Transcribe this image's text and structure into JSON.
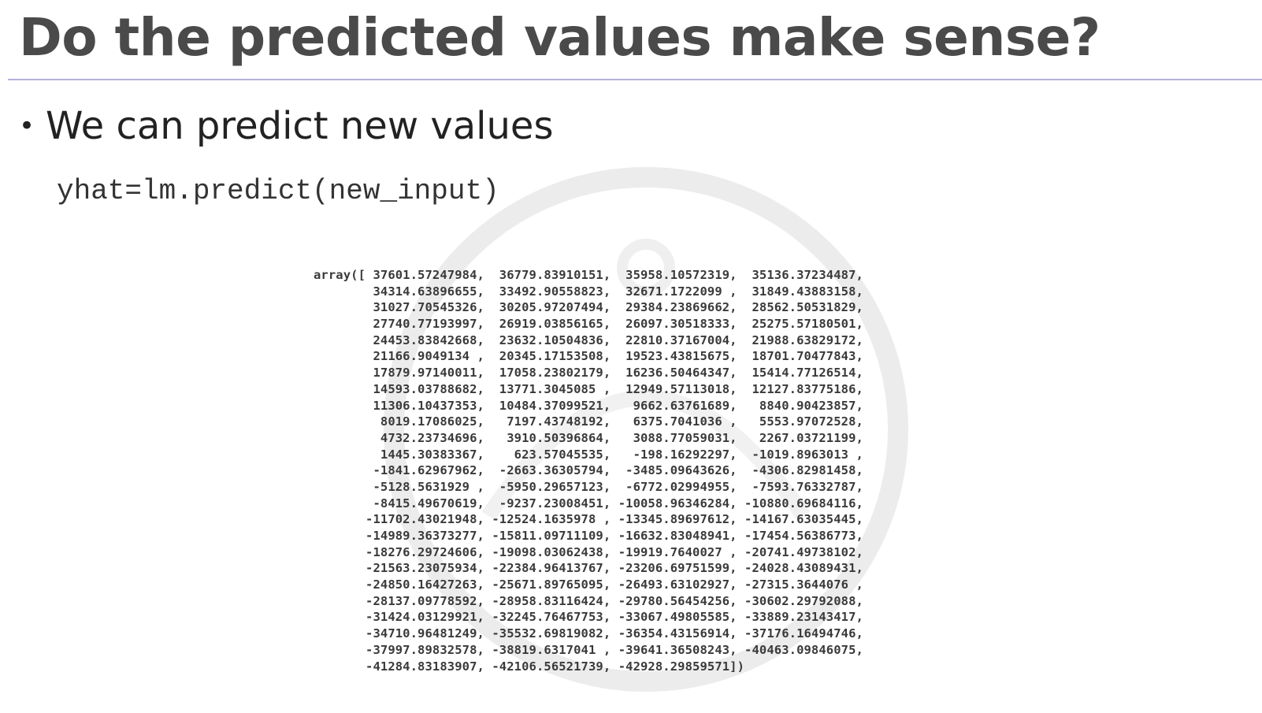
{
  "slide": {
    "title": "Do the predicted values make sense?",
    "bullet": "We can predict new values",
    "code": "yhat=lm.predict(new_input)"
  },
  "output": {
    "lines": [
      "array([ 37601.57247984,  36779.83910151,  35958.10572319,  35136.37234487,",
      "        34314.63896655,  33492.90558823,  32671.1722099 ,  31849.43883158,",
      "        31027.70545326,  30205.97207494,  29384.23869662,  28562.50531829,",
      "        27740.77193997,  26919.03856165,  26097.30518333,  25275.57180501,",
      "        24453.83842668,  23632.10504836,  22810.37167004,  21988.63829172,",
      "        21166.9049134 ,  20345.17153508,  19523.43815675,  18701.70477843,",
      "        17879.97140011,  17058.23802179,  16236.50464347,  15414.77126514,",
      "        14593.03788682,  13771.3045085 ,  12949.57113018,  12127.83775186,",
      "        11306.10437353,  10484.37099521,   9662.63761689,   8840.90423857,",
      "         8019.17086025,   7197.43748192,   6375.7041036 ,   5553.97072528,",
      "         4732.23734696,   3910.50396864,   3088.77059031,   2267.03721199,",
      "         1445.30383367,    623.57045535,   -198.16292297,  -1019.8963013 ,",
      "        -1841.62967962,  -2663.36305794,  -3485.09643626,  -4306.82981458,",
      "        -5128.5631929 ,  -5950.29657123,  -6772.02994955,  -7593.76332787,",
      "        -8415.49670619,  -9237.23008451, -10058.96346284, -10880.69684116,",
      "       -11702.43021948, -12524.1635978 , -13345.89697612, -14167.63035445,",
      "       -14989.36373277, -15811.09711109, -16632.83048941, -17454.56386773,",
      "       -18276.29724606, -19098.03062438, -19919.7640027 , -20741.49738102,",
      "       -21563.23075934, -22384.96413767, -23206.69751599, -24028.43089431,",
      "       -24850.16427263, -25671.89765095, -26493.63102927, -27315.3644076 ,",
      "       -28137.09778592, -28958.83116424, -29780.56454256, -30602.29792088,",
      "       -31424.03129921, -32245.76467753, -33067.49805585, -33889.23143417,",
      "       -34710.96481249, -35532.69819082, -36354.43156914, -37176.16494746,",
      "       -37997.89832578, -38819.6317041 , -39641.36508243, -40463.09846075,",
      "       -41284.83183907, -42106.56521739, -42928.29859571])"
    ]
  },
  "colors": {
    "title": "#4a4a4a",
    "rule": "#b3b0de",
    "watermark": "#e6e6e6"
  },
  "watermark_icon": "brand-logo-watermark"
}
